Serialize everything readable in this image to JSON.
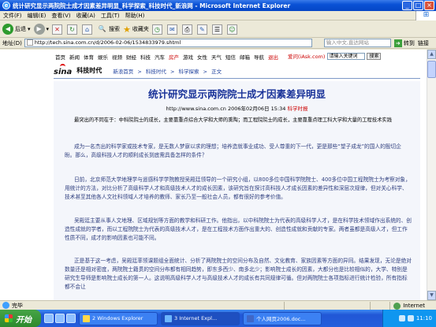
{
  "window": {
    "title": "统计研究显示两院院士成才因素差异明显_科学探索_科技时代_新浪网 - Microsoft Internet Explorer",
    "min": "_",
    "max": "□",
    "close": "×"
  },
  "menu": [
    "文件(F)",
    "编辑(E)",
    "查看(V)",
    "收藏(A)",
    "工具(T)",
    "帮助(H)"
  ],
  "toolbar": {
    "back": "后退",
    "search": "搜索",
    "favorites": "收藏夹"
  },
  "address": {
    "label": "地址(D)",
    "url": "http://tech.sina.com.cn/d/2006-02-06/1534833979.shtml",
    "search_placeholder": "输入中文,直达网站",
    "go": "转到",
    "links": "链接"
  },
  "topnav": [
    "首页",
    "新闻",
    "体育",
    "娱乐",
    "视频",
    "财经",
    "科技",
    "汽车",
    "房产",
    "游戏",
    "女性",
    "天气",
    "短信",
    "邮箱",
    "导航",
    "退出"
  ],
  "login": {
    "text": "爱问(iAsk.com)",
    "placeholder": "请输入关键词",
    "button": "搜索"
  },
  "header": {
    "logo": "sina",
    "channel": "科技时代",
    "crumbs": [
      "新浪首页",
      ">",
      "科技时代",
      ">",
      "科学探索",
      ">",
      "正文"
    ]
  },
  "article": {
    "title": "统计研究显示两院院士成才因素差异明显",
    "meta": "http://www.sina.com.cn  2006年02月06日 15:34",
    "source": "科学时报",
    "summary": "最突出的不同在于：中科院院士的成长，主要靠重点综合大学和大师的熏陶；而工程院院士的成长，主要靠重点理工科大学和大量的工程技术实践",
    "paragraphs": [
      "成为一名杰出的科学家或技术专家，是无数人梦寐以求的理想；培养造就事业成功、受人尊重的下一代，更是那些“望子成龙”的国人的殷切企盼。那么，高级科技人才的顺利成长到底需具备怎样的条件？",
      "日前，北京师范大学地理学与遥感科学学院教授吴殿廷领导的一个研究小组，以800多位中国科学院院士、400多位中国工程院院士为考察对象，用统计的方法，对比分析了高级科学人才和高级技术人才的成长因素，该研究旨在探讨高科技人才成长因素的差异性和深层次规律，但对关心科学、技术甚至其他各人文社科领域人才培养的教师、家长乃至一般社会人员，都有很好的参考价值。",
      "吴殿廷主要从事人文地理、区域规划等方面的教学和科研工作。他指出，以中科院院士为代表的高级科学人才，是在科学技术领域作出系统的、创造性成就的学者，而以工程院院士为代表的高级技术人才，是在工程技术方面作出重大的、创造性成就和贡献的专家。两者虽都是高级人才，但工作性质不同，成才的影响因素也可能不同。",
      "正是基于这一考虑，吴殿廷率领课题组全面统计、分析了两院院士的空间分布及自然、文化教育、家族因素等方面的异同。结果发现，无论是绝对数量还是相对密度，两院院士籍贯的空间分布都有相同趋势，即东多西少、南多北少；影响院士成长的因素，大都分也是比较相似的，大学、特别是研究生导师是影响院士成长的第一人。这说明高级科学人才与高级技术人才的成长有共同规律可循。但对两院院士各项指标进行统计检验，所有指标都不会让"
    ]
  },
  "status": {
    "left": "完毕",
    "zone": "Internet"
  },
  "taskbar": {
    "start": "开始",
    "tasks": [
      "2 Windows Explorer",
      "3 Internet Expl...",
      "个人网页2006.doc..."
    ],
    "time": "11:10"
  }
}
